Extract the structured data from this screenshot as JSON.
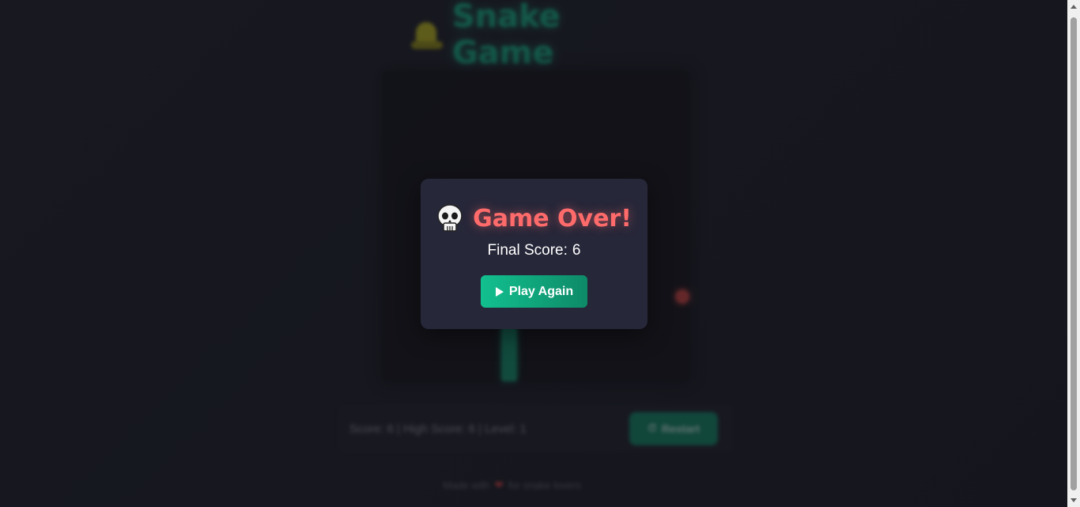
{
  "game": {
    "title": "Snake Game",
    "title_icon": "snake-icon",
    "status_text": "Score: 6 | High Score: 6 | Level: 1",
    "status_button_label": "Restart",
    "status_button_icon": "restart-icon",
    "footer_text_left": "Made with",
    "footer_text_right": "for snake lovers",
    "footer_icon": "heart-icon"
  },
  "modal": {
    "title": "Game Over!",
    "title_icon": "skull-icon",
    "final_score_label": "Final Score:",
    "final_score_value": "6",
    "play_again_label": "Play Again",
    "play_again_icon": "play-icon"
  },
  "colors": {
    "accent": "#12c08f",
    "game_over": "#ff6b6b",
    "modal_bg": "#262739",
    "page_bg": "#1c1d26",
    "food": "#d9443f"
  }
}
